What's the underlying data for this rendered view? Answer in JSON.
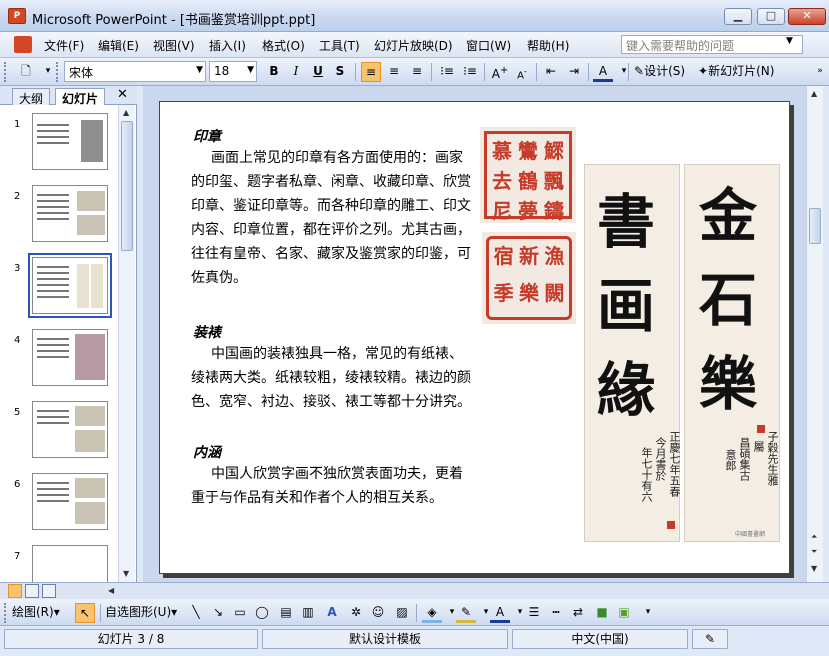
{
  "window": {
    "title": "Microsoft PowerPoint - [书画鉴赏培训ppt.ppt]",
    "app_icon": "powerpoint-icon"
  },
  "menu": {
    "items": [
      "文件(F)",
      "编辑(E)",
      "视图(V)",
      "插入(I)",
      "格式(O)",
      "工具(T)",
      "幻灯片放映(D)",
      "窗口(W)",
      "帮助(H)"
    ],
    "help_placeholder": "键入需要帮助的问题"
  },
  "toolbar": {
    "font_name": "宋体",
    "font_size": "18",
    "bold": "B",
    "italic": "I",
    "underline": "U",
    "shadow": "S",
    "design_label": "设计(S)",
    "new_slide_label": "新幻灯片(N)"
  },
  "leftpane": {
    "tabs": [
      "大纲",
      "幻灯片"
    ],
    "selected_tab": "幻灯片",
    "slide_numbers": [
      "1",
      "2",
      "3",
      "4",
      "5",
      "6",
      "7"
    ],
    "selected_slide": 3
  },
  "slide": {
    "sections": [
      {
        "heading": "印章",
        "text": "画面上常见的印章有各方面使用的：画家的印玺、题字者私章、闲章、收藏印章、欣赏印章、鉴证印章等。而各种印章的雕工、印文内容、印章位置，都在评价之列。尤其古画，往往有皇帝、名家、藏家及鉴赏家的印鉴，可佐真伪。"
      },
      {
        "heading": "装裱",
        "text": "中国画的装裱独具一格，常见的有纸裱、绫裱两大类。纸裱较粗，绫裱较精。裱边的颜色、宽窄、衬边、接驳、裱工等都十分讲究。"
      },
      {
        "heading": "内涵",
        "text": "中国人欣赏字画不独欣赏表面功夫，更着重于与作品有关和作者个人的相互关系。"
      }
    ],
    "seal1_chars": [
      "慕",
      "鸞",
      "鰥",
      "去",
      "鶴",
      "飄",
      "尼",
      "夢",
      "鑄"
    ],
    "seal2_chars": [
      "宿",
      "新",
      "漁",
      "季",
      "樂",
      "闕"
    ],
    "scroll_left_chars": [
      "書",
      "画",
      "緣"
    ],
    "scroll_left_inscription": [
      "正慶七年五春",
      "今月書於",
      "年七十有六"
    ],
    "scroll_right_chars": [
      "金",
      "石",
      "樂"
    ],
    "scroll_right_inscription": [
      "子穀先生雅",
      "屬",
      "昌碩集古",
      "意郎"
    ],
    "watermark": "中國書畫網"
  },
  "status": {
    "slide_info": "幻灯片 3 / 8",
    "template": "默认设计模板",
    "language": "中文(中国)"
  },
  "drawbar": {
    "draw_label": "绘图(R)",
    "autoshape_label": "自选图形(U)"
  },
  "colors": {
    "accent": "#f9c36b",
    "seal_red": "#c63b28",
    "selection_border": "#2b55b8"
  }
}
